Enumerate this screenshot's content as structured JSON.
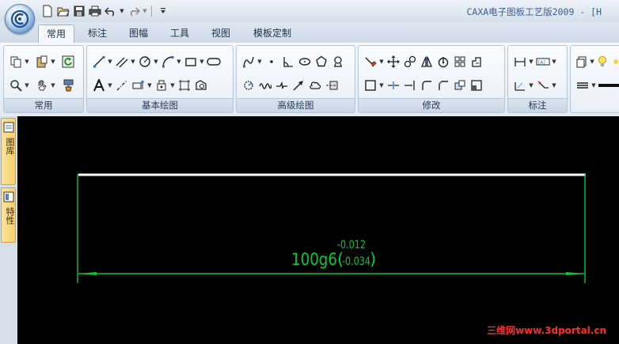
{
  "window": {
    "title": "CAXA电子图板工艺版2009 - [H"
  },
  "quick_access": {
    "icons": [
      "new-file-icon",
      "open-folder-icon",
      "save-icon",
      "print-icon",
      "undo-icon",
      "redo-icon",
      "customize-icon"
    ]
  },
  "tabs": [
    {
      "label": "常用",
      "active": true
    },
    {
      "label": "标注",
      "active": false
    },
    {
      "label": "图幅",
      "active": false
    },
    {
      "label": "工具",
      "active": false
    },
    {
      "label": "视图",
      "active": false
    },
    {
      "label": "模板定制",
      "active": false
    }
  ],
  "ribbon": {
    "groups": [
      {
        "caption": "常用"
      },
      {
        "caption": "基本绘图"
      },
      {
        "caption": "高级绘图"
      },
      {
        "caption": "修改"
      },
      {
        "caption": "标注"
      }
    ]
  },
  "left_panel": {
    "tabs": [
      "图库",
      "特性"
    ]
  },
  "drawing": {
    "dimension_text": "100g6",
    "upper_tolerance": "-0.012",
    "lower_tolerance": "-0.034",
    "open_paren": "(",
    "close_paren": ")",
    "colors": {
      "background": "#000000",
      "part_line": "#ffffff",
      "dimension": "#00cc33"
    }
  },
  "watermark": "三维网www.3dportal.cn"
}
